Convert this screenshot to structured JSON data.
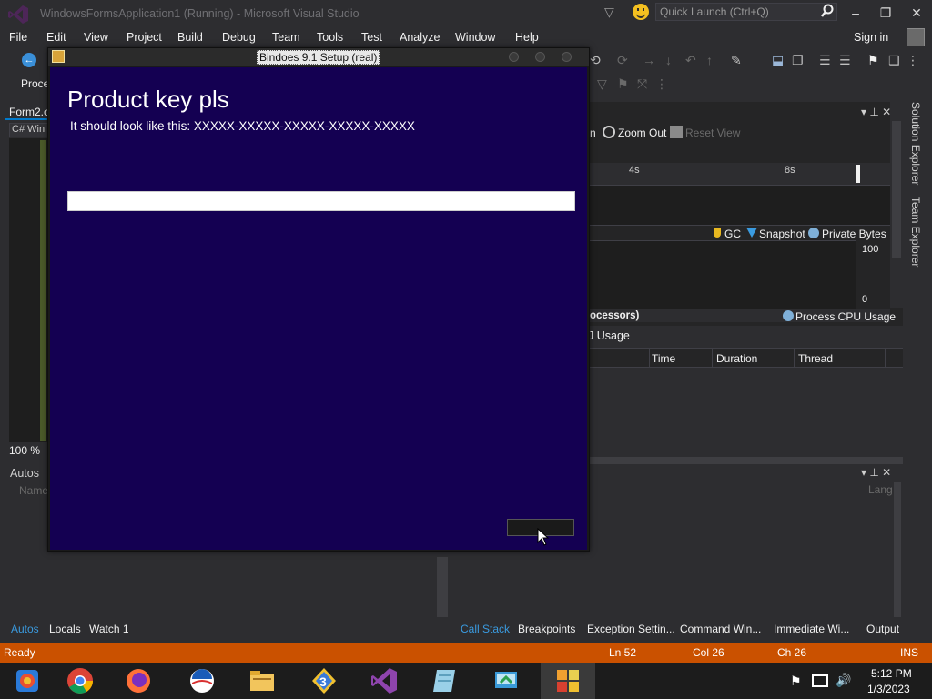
{
  "app": {
    "title": "WindowsFormsApplication1 (Running) - Microsoft Visual Studio",
    "quick_launch_placeholder": "Quick Launch (Ctrl+Q)",
    "sign_in": "Sign in",
    "window_controls": {
      "minimize": "–",
      "restore": "❐",
      "close": "✕"
    }
  },
  "menu": [
    "File",
    "Edit",
    "View",
    "Project",
    "Build",
    "Debug",
    "Team",
    "Tools",
    "Test",
    "Analyze",
    "Window",
    "Help"
  ],
  "left_panel": {
    "process_label": "Proce",
    "doc_tab": "Form2.c",
    "nav_chip": "C# Win",
    "zoom": "100 %",
    "autos_title": "Autos",
    "name_column": "Name",
    "bottom_tabs": {
      "autos": "Autos",
      "locals": "Locals",
      "watch1": "Watch 1"
    }
  },
  "diagnostics": {
    "toolbar_fragment": "n",
    "zoom_out": "Zoom Out",
    "reset_view": "Reset View",
    "timeline_labels": {
      "t4": "4s",
      "t8": "8s"
    },
    "memory_legend": {
      "gc": "GC",
      "snapshot": "Snapshot",
      "private_bytes": "Private Bytes"
    },
    "memory_axis": {
      "max": "100",
      "min": "0"
    },
    "cpu_left_fragment": "ocessors)",
    "cpu_legend": "Process CPU Usage",
    "cpu_section_title": "J Usage",
    "events_columns": {
      "time": "Time",
      "duration": "Duration",
      "thread": "Thread"
    },
    "lang_column": "Lang"
  },
  "bottom_right_tabs": {
    "call_stack": "Call Stack",
    "breakpoints": "Breakpoints",
    "exception_settings": "Exception Settin...",
    "command_window": "Command Win...",
    "immediate_window": "Immediate Wi...",
    "output": "Output"
  },
  "side_tabs": {
    "solution_explorer": "Solution Explorer",
    "team_explorer": "Team Explorer"
  },
  "setup_dialog": {
    "title": "Bindoes 9.1 Setup (real)",
    "heading": "Product key pls",
    "hint": "It should look like this: XXXXX-XXXXX-XXXXX-XXXXX-XXXXX",
    "product_key_value": "",
    "background_color": "#140052"
  },
  "statusbar": {
    "state": "Ready",
    "line": "Ln 52",
    "column": "Col 26",
    "char": "Ch 26",
    "mode": "INS",
    "color": "#ca5100"
  },
  "taskbar": {
    "apps": [
      "photos-icon",
      "chrome-icon",
      "firefox-icon",
      "obama-logo-icon",
      "file-explorer-icon",
      "app-3-icon",
      "visual-studio-icon",
      "notepad-icon",
      "remote-app-icon",
      "setup-app-icon"
    ],
    "time": "5:12 PM",
    "date": "1/3/2023"
  }
}
